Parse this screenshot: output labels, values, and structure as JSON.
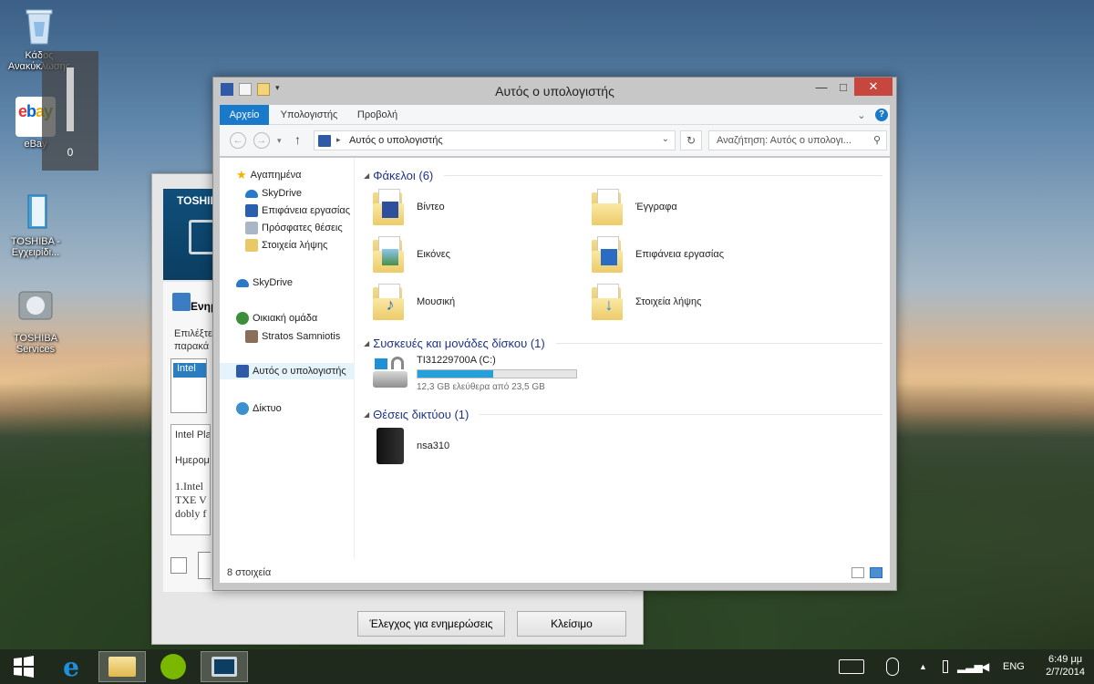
{
  "desktop": {
    "icons": [
      {
        "label": "Κάδος Ανακύκλωσης"
      },
      {
        "label": "eBay"
      },
      {
        "label": "TOSHIBA - Εγχειρίδι..."
      },
      {
        "label": "TOSHIBA Services"
      }
    ],
    "volume": {
      "value": "0",
      "level": 0
    }
  },
  "toshiba_window": {
    "brand": "TOSHIBA",
    "title_partial": "Ενημ",
    "desc_line1": "Επιλέξτε",
    "desc_line2": "παρακά",
    "list_item": "Intel",
    "info_line1": "Intel Pla",
    "info_line2": "Ημερομ",
    "info_line3": "1.Intel",
    "info_line4": "TXE V",
    "info_line5": "dobly f",
    "check_updates_label": "Έλεγχος για ενημερώσεις",
    "close_label": "Κλείσιμο"
  },
  "explorer": {
    "title": "Αυτός ο υπολογιστής",
    "window_buttons": {
      "minimize": "—",
      "maximize": "□",
      "close": "✕"
    },
    "ribbon_tabs": [
      "Αρχείο",
      "Υπολογιστής",
      "Προβολή"
    ],
    "address": "Αυτός ο υπολογιστής",
    "search_placeholder": "Αναζήτηση: Αυτός ο υπολογι...",
    "nav": {
      "favorites": "Αγαπημένα",
      "fav_items": [
        "SkyDrive",
        "Επιφάνεια εργασίας",
        "Πρόσφατες θέσεις",
        "Στοιχεία λήψης"
      ],
      "skydrive": "SkyDrive",
      "homegroup": "Οικιακή ομάδα",
      "homegroup_user": "Stratos Samniotis",
      "this_pc": "Αυτός ο υπολογιστής",
      "network": "Δίκτυο"
    },
    "groups": {
      "folders": "Φάκελοι (6)",
      "devices": "Συσκευές και μονάδες δίσκου (1)",
      "network": "Θέσεις δικτύου (1)"
    },
    "folders": [
      "Βίντεο",
      "Έγγραφα",
      "Εικόνες",
      "Επιφάνεια εργασίας",
      "Μουσική",
      "Στοιχεία λήψης"
    ],
    "drive": {
      "name": "TI31229700A (C:)",
      "free_text": "12,3 GB ελεύθερα από 23,5 GB",
      "used_fraction": 0.477
    },
    "network_item": "nsa310",
    "status": "8 στοιχεία"
  },
  "taskbar": {
    "language": "ENG",
    "time": "6:49 μμ",
    "date": "2/7/2014"
  },
  "colors": {
    "accent": "#1979ca",
    "group_header": "#1e3287",
    "close_button": "#c7463e",
    "drive_fill": "#26a0da"
  }
}
